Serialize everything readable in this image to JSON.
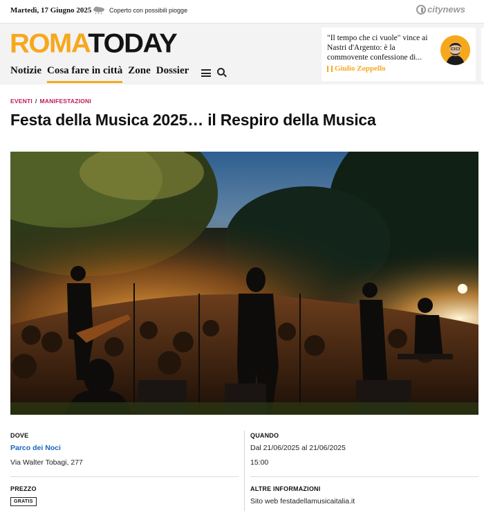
{
  "topbar": {
    "date": "Martedì, 17 Giugno 2025",
    "weather_icon": "cloud-rain-icon",
    "weather_text": "Coperto con possibili piogge",
    "network_logo": "citynews"
  },
  "header": {
    "logo_part1": "ROMA",
    "logo_part2": "TODAY",
    "brand_color": "#f6a81d",
    "nav": [
      {
        "label": "Notizie",
        "active": false
      },
      {
        "label": "Cosa fare in città",
        "active": true
      },
      {
        "label": "Zone",
        "active": false
      },
      {
        "label": "Dossier",
        "active": false
      }
    ],
    "menu_icon": "hamburger-icon",
    "search_icon": "search-icon",
    "promo": {
      "text": "\"Il tempo che ci vuole\" vince ai Nastri d'Argento: è la commovente confessione di...",
      "author": "Giulio Zoppello"
    }
  },
  "article": {
    "breadcrumb": [
      "EVENTI",
      "/",
      "MANIFESTAZIONI"
    ],
    "title": "Festa della Musica 2025… il Respiro della Musica",
    "info": {
      "where_label": "DOVE",
      "where_place": "Parco dei Noci",
      "where_address": "Via Walter Tobagi, 277",
      "when_label": "QUANDO",
      "when_dates": "Dal 21/06/2025 al 21/06/2025",
      "when_time": "15:00",
      "price_label": "PREZZO",
      "price_value": "GRATIS",
      "more_label": "ALTRE INFORMAZIONI",
      "more_value": "Sito web festadellamusicaitalia.it"
    }
  }
}
